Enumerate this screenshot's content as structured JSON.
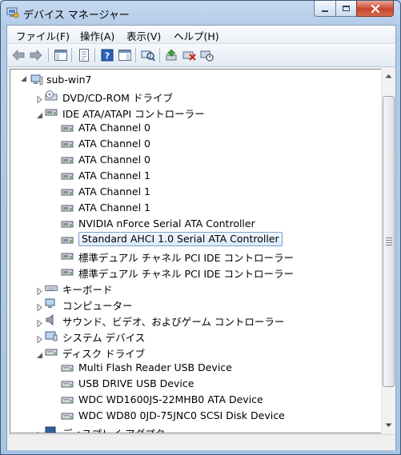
{
  "window": {
    "title": "デバイス マネージャー"
  },
  "menu": [
    {
      "label": "ファイル(F)"
    },
    {
      "label": "操作(A)"
    },
    {
      "label": "表示(V)"
    },
    {
      "label": "ヘルプ(H)"
    }
  ],
  "toolbar": [
    {
      "name": "back-icon"
    },
    {
      "name": "forward-icon"
    },
    {
      "name": "show-hide-console-tree-icon"
    },
    {
      "name": "properties-icon"
    },
    {
      "name": "help-icon"
    },
    {
      "name": "action-pane-icon"
    },
    {
      "name": "scan-hardware-icon"
    },
    {
      "name": "update-driver-icon"
    },
    {
      "name": "uninstall-icon"
    },
    {
      "name": "disable-device-icon"
    }
  ],
  "tree": {
    "root": "sub-win7",
    "items": [
      {
        "label": "DVD/CD-ROM ドライブ",
        "level": 1,
        "expander": "collapsed",
        "icon": "dvd-drive-icon"
      },
      {
        "label": "IDE ATA/ATAPI コントローラー",
        "level": 1,
        "expander": "expanded",
        "icon": "ide-controller-icon"
      },
      {
        "label": "ATA Channel 0",
        "level": 2,
        "expander": "none",
        "icon": "ide-channel-icon"
      },
      {
        "label": "ATA Channel 0",
        "level": 2,
        "expander": "none",
        "icon": "ide-channel-icon"
      },
      {
        "label": "ATA Channel 0",
        "level": 2,
        "expander": "none",
        "icon": "ide-channel-icon"
      },
      {
        "label": "ATA Channel 1",
        "level": 2,
        "expander": "none",
        "icon": "ide-channel-icon"
      },
      {
        "label": "ATA Channel 1",
        "level": 2,
        "expander": "none",
        "icon": "ide-channel-icon"
      },
      {
        "label": "ATA Channel 1",
        "level": 2,
        "expander": "none",
        "icon": "ide-channel-icon"
      },
      {
        "label": "NVIDIA nForce Serial ATA Controller",
        "level": 2,
        "expander": "none",
        "icon": "ide-channel-icon"
      },
      {
        "label": "Standard AHCI 1.0 Serial ATA Controller",
        "level": 2,
        "expander": "none",
        "icon": "ide-channel-icon",
        "selected": true
      },
      {
        "label": "標準デュアル チャネル PCI IDE コントローラー",
        "level": 2,
        "expander": "none",
        "icon": "ide-channel-icon"
      },
      {
        "label": "標準デュアル チャネル PCI IDE コントローラー",
        "level": 2,
        "expander": "none",
        "icon": "ide-channel-icon"
      },
      {
        "label": "キーボード",
        "level": 1,
        "expander": "collapsed",
        "icon": "keyboard-icon"
      },
      {
        "label": "コンピューター",
        "level": 1,
        "expander": "collapsed",
        "icon": "computer-icon"
      },
      {
        "label": "サウンド、ビデオ、およびゲーム コントローラー",
        "level": 1,
        "expander": "collapsed",
        "icon": "speaker-icon"
      },
      {
        "label": "システム デバイス",
        "level": 1,
        "expander": "collapsed",
        "icon": "system-device-icon"
      },
      {
        "label": "ディスク ドライブ",
        "level": 1,
        "expander": "expanded",
        "icon": "disk-drive-icon"
      },
      {
        "label": "Multi Flash Reader USB Device",
        "level": 2,
        "expander": "none",
        "icon": "disk-drive-icon"
      },
      {
        "label": "USB DRIVE USB Device",
        "level": 2,
        "expander": "none",
        "icon": "disk-drive-icon"
      },
      {
        "label": "WDC WD1600JS-22MHB0 ATA Device",
        "level": 2,
        "expander": "none",
        "icon": "disk-drive-icon"
      },
      {
        "label": "WDC WD80 0JD-75JNC0 SCSI Disk Device",
        "level": 2,
        "expander": "none",
        "icon": "disk-drive-icon"
      },
      {
        "label": "ディスプレイ アダプター",
        "level": 1,
        "expander": "collapsed",
        "icon": "display-adapter-icon"
      }
    ]
  },
  "colors": {
    "selection_border": "#7da2ce",
    "close_button": "#c8452c",
    "title_bar": "#b3cce8"
  }
}
